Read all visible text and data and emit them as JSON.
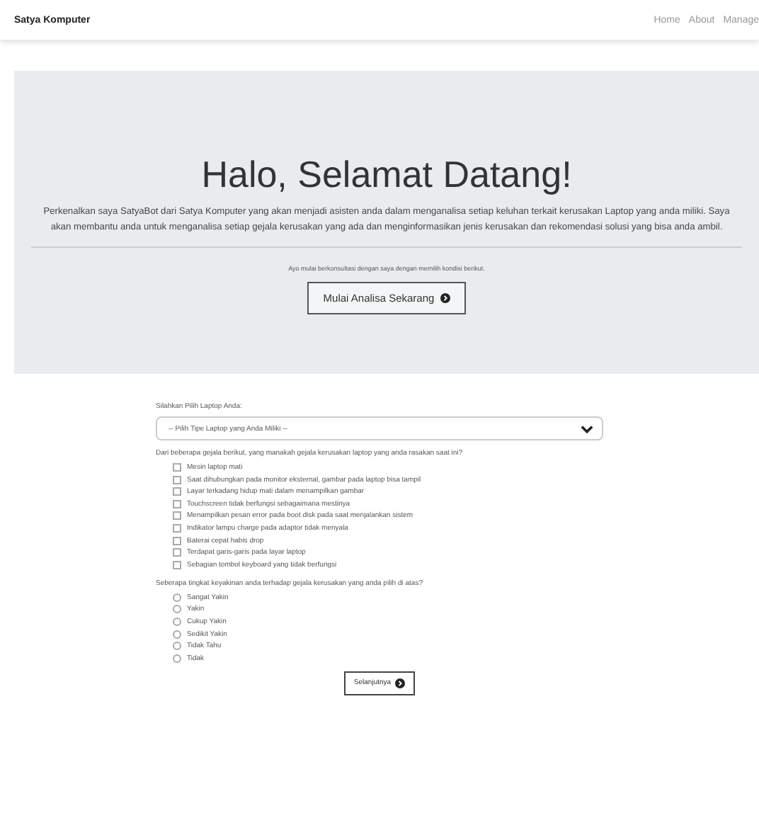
{
  "navbar": {
    "brand": "Satya Komputer",
    "links": [
      "Home",
      "About",
      "Manage"
    ]
  },
  "jumbotron": {
    "title": "Halo, Selamat Datang!",
    "intro": "Perkenalkan saya SatyaBot dari Satya Komputer yang akan menjadi asisten anda dalam menganalisa setiap keluhan terkait kerusakan Laptop yang anda miliki. Saya akan membantu anda untuk menganalisa setiap gejala kerusakan yang ada dan menginformasikan jenis kerusakan dan rekomendasi solusi yang bisa anda ambil.",
    "hint": "Ayo mulai berkonsultasi dengan saya dengan memilih kondisi berikut.",
    "button": "Mulai Analisa Sekarang"
  },
  "form": {
    "select_label": "Silahkan Pilih Laptop Anda:",
    "select_value": "-- Pilih Tipe Laptop yang Anda Miliki --",
    "question_1": "Dari beberapa gejala berikut, yang manakah gejala kerusakan laptop yang anda rasakan saat ini?",
    "symptoms": [
      {
        "label": "Mesin laptop mati",
        "checked": false
      },
      {
        "label": "Saat dihubungkan pada monitor eksternal, gambar pada laptop bisa tampil",
        "checked": false
      },
      {
        "label": "Layar terkadang hidup mati dalam menampilkan gambar",
        "checked": false
      },
      {
        "label": "Touchscreen tidak berfungsi sebagaimana mestinya",
        "checked": false
      },
      {
        "label": "Menampilkan pesan error pada boot disk pada saat menjalankan sistem",
        "checked": false
      },
      {
        "label": "Indikator lampu charge pada adaptor tidak menyala",
        "checked": false
      },
      {
        "label": "Baterai cepat habis drop",
        "checked": false
      },
      {
        "label": "Terdapat garis-garis pada layar laptop",
        "checked": false
      },
      {
        "label": "Sebagian tombol keyboard yang tidak berfungsi",
        "checked": false
      }
    ],
    "question_2": "Seberapa tingkat keyakinan anda terhadap gejala kerusakan yang anda pilih di atas?",
    "confidence": [
      {
        "label": "Sangat Yakin",
        "selected": false
      },
      {
        "label": "Yakin",
        "selected": false
      },
      {
        "label": "Cukup Yakin",
        "selected": false
      },
      {
        "label": "Sedikit Yakin",
        "selected": false
      },
      {
        "label": "Tidak Tahu",
        "selected": false
      },
      {
        "label": "Tidak",
        "selected": false
      }
    ],
    "button": "Selanjutnya"
  }
}
